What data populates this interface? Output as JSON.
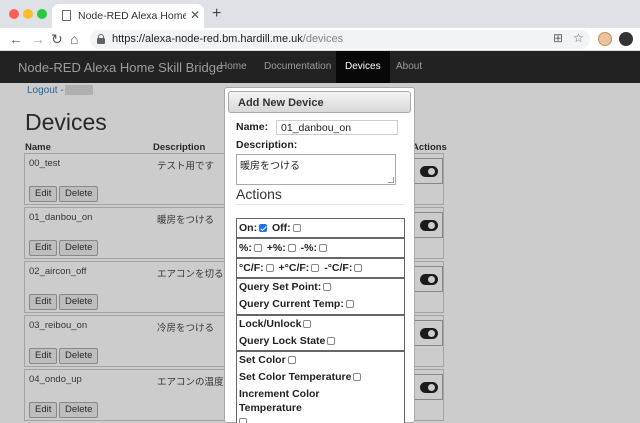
{
  "browser": {
    "tab_title": "Node-RED Alexa Home Skill Br",
    "url_host": "https://alexa-node-red.bm.hardill.me.uk",
    "url_path": "/devices"
  },
  "navbar": {
    "brand": "Node-RED Alexa Home Skill Bridge",
    "links": [
      {
        "label": "Home"
      },
      {
        "label": "Documentation"
      },
      {
        "label": "Devices"
      },
      {
        "label": "About"
      }
    ],
    "active": "Devices"
  },
  "page": {
    "logout_label": "Logout -",
    "title": "Devices",
    "headers": {
      "name": "Name",
      "description": "Description",
      "actions": "Actions"
    },
    "edit_label": "Edit",
    "delete_label": "Delete"
  },
  "devices": [
    {
      "name": "00_test",
      "description": "テスト用です"
    },
    {
      "name": "01_danbou_on",
      "description": "暖房をつける"
    },
    {
      "name": "02_aircon_off",
      "description": "エアコンを切る"
    },
    {
      "name": "03_reibou_on",
      "description": "冷房をつける"
    },
    {
      "name": "04_ondo_up",
      "description": "エアコンの温度を"
    }
  ],
  "dialog": {
    "title": "Add New Device",
    "name_label": "Name:",
    "name_value": "01_danbou_on",
    "description_label": "Description:",
    "description_value": "暖房をつける",
    "actions_title": "Actions",
    "action_groups": [
      {
        "lines": [
          [
            {
              "label": "On:",
              "checked": true
            },
            {
              "label": "Off:",
              "checked": false
            }
          ]
        ]
      },
      {
        "lines": [
          [
            {
              "label": "%:",
              "checked": false
            },
            {
              "label": "+%:",
              "checked": false
            },
            {
              "label": "-%:",
              "checked": false
            }
          ]
        ]
      },
      {
        "lines": [
          [
            {
              "label": "°C/F:",
              "checked": false
            },
            {
              "label": "+°C/F:",
              "checked": false
            },
            {
              "label": "-°C/F:",
              "checked": false
            }
          ]
        ]
      },
      {
        "lines": [
          [
            {
              "label": "Query Set Point:",
              "checked": false
            }
          ],
          [
            {
              "label": "Query Current Temp:",
              "checked": false
            }
          ]
        ]
      },
      {
        "lines": [
          [
            {
              "label": "Lock/Unlock",
              "checked": false
            }
          ],
          [
            {
              "label": "Query Lock State",
              "checked": false
            }
          ]
        ]
      },
      {
        "lines": [
          [
            {
              "label": "Set Color",
              "checked": false
            }
          ],
          [
            {
              "label": "Set Color Temperature",
              "checked": false
            }
          ],
          [
            {
              "label": "Increment Color",
              "checked": null
            }
          ],
          [
            {
              "label": "Temperature",
              "checked": null
            }
          ]
        ]
      }
    ]
  }
}
